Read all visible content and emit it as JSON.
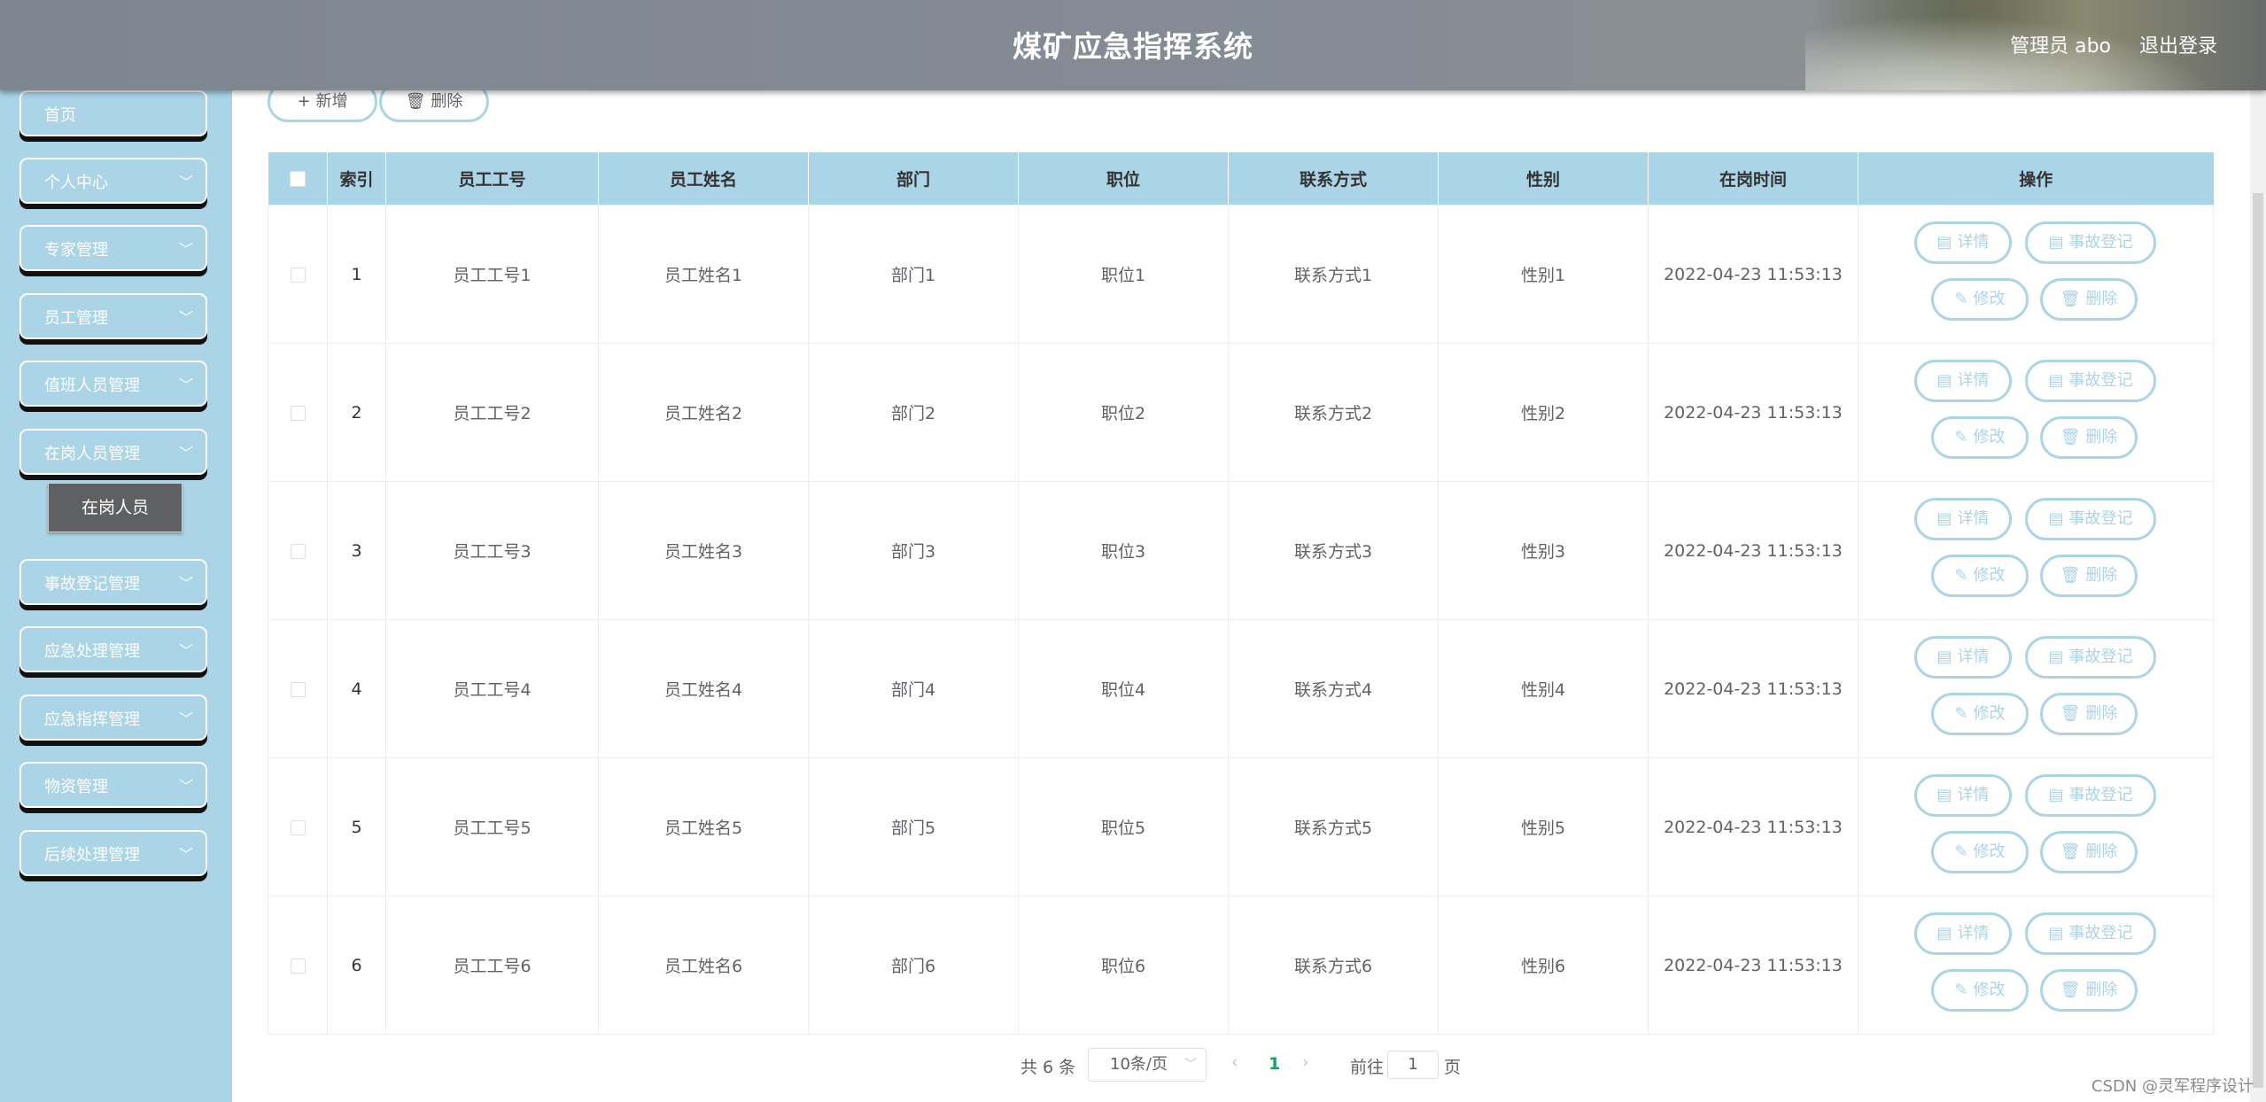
{
  "header": {
    "title": "煤矿应急指挥系统",
    "user": "管理员 abo",
    "logout": "退出登录"
  },
  "sidebar": {
    "items": [
      {
        "label": "首页",
        "chevron": ""
      },
      {
        "label": "个人中心",
        "chevron": "﹀"
      },
      {
        "label": "专家管理",
        "chevron": "﹀"
      },
      {
        "label": "员工管理",
        "chevron": "﹀"
      },
      {
        "label": "值班人员管理",
        "chevron": "﹀"
      },
      {
        "label": "在岗人员管理",
        "chevron": "﹀"
      },
      {
        "label": "事故登记管理",
        "chevron": "﹀"
      },
      {
        "label": "应急处理管理",
        "chevron": "﹀"
      },
      {
        "label": "应急指挥管理",
        "chevron": "﹀"
      },
      {
        "label": "物资管理",
        "chevron": "﹀"
      },
      {
        "label": "后续处理管理",
        "chevron": "﹀"
      }
    ],
    "active_sub": "在岗人员"
  },
  "toolbar": {
    "add_label": "新增",
    "delete_label": "删除"
  },
  "table": {
    "headers": [
      "索引",
      "员工工号",
      "员工姓名",
      "部门",
      "职位",
      "联系方式",
      "性别",
      "在岗时间",
      "操作"
    ],
    "rows": [
      {
        "index": "1",
        "emp_no": "员工工号1",
        "name": "员工姓名1",
        "dept": "部门1",
        "position": "职位1",
        "contact": "联系方式1",
        "gender": "性别1",
        "time": "2022-04-23 11:53:13"
      },
      {
        "index": "2",
        "emp_no": "员工工号2",
        "name": "员工姓名2",
        "dept": "部门2",
        "position": "职位2",
        "contact": "联系方式2",
        "gender": "性别2",
        "time": "2022-04-23 11:53:13"
      },
      {
        "index": "3",
        "emp_no": "员工工号3",
        "name": "员工姓名3",
        "dept": "部门3",
        "position": "职位3",
        "contact": "联系方式3",
        "gender": "性别3",
        "time": "2022-04-23 11:53:13"
      },
      {
        "index": "4",
        "emp_no": "员工工号4",
        "name": "员工姓名4",
        "dept": "部门4",
        "position": "职位4",
        "contact": "联系方式4",
        "gender": "性别4",
        "time": "2022-04-23 11:53:13"
      },
      {
        "index": "5",
        "emp_no": "员工工号5",
        "name": "员工姓名5",
        "dept": "部门5",
        "position": "职位5",
        "contact": "联系方式5",
        "gender": "性别5",
        "time": "2022-04-23 11:53:13"
      },
      {
        "index": "6",
        "emp_no": "员工工号6",
        "name": "员工姓名6",
        "dept": "部门6",
        "position": "职位6",
        "contact": "联系方式6",
        "gender": "性别6",
        "time": "2022-04-23 11:53:13"
      }
    ],
    "actions": {
      "detail": "详情",
      "accident": "事故登记",
      "edit": "修改",
      "delete": "删除"
    }
  },
  "pagination": {
    "total": "共 6 条",
    "page_size": "10条/页",
    "current_page": "1",
    "goto_prefix": "前往",
    "goto_value": "1",
    "goto_suffix": "页",
    "prev": "‹",
    "next": "›"
  },
  "watermark": "CSDN @灵军程序设计",
  "colors": {
    "accent": "#abd4e6",
    "header_bg": "#858c95",
    "submenu_bg": "#5f6061"
  }
}
